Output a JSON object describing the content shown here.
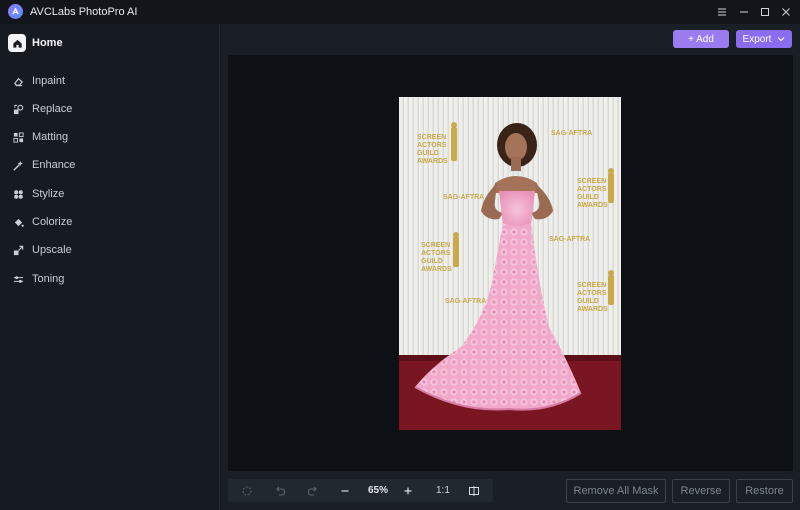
{
  "window": {
    "title": "AVCLabs PhotoPro AI",
    "logo_icon": "avclabs-logo-icon",
    "controls": [
      "menu-icon",
      "minimize-icon",
      "maximize-icon",
      "close-icon"
    ]
  },
  "sidebar": {
    "home": {
      "label": "Home",
      "icon": "home-icon"
    },
    "items": [
      {
        "label": "Inpaint",
        "icon": "eraser-icon"
      },
      {
        "label": "Replace",
        "icon": "replace-icon"
      },
      {
        "label": "Matting",
        "icon": "matting-icon"
      },
      {
        "label": "Enhance",
        "icon": "enhance-icon"
      },
      {
        "label": "Stylize",
        "icon": "stylize-icon"
      },
      {
        "label": "Colorize",
        "icon": "colorize-icon"
      },
      {
        "label": "Upscale",
        "icon": "upscale-icon"
      },
      {
        "label": "Toning",
        "icon": "toning-icon"
      }
    ]
  },
  "header": {
    "add_label": "+ Add",
    "export_label": "Export"
  },
  "photo": {
    "backdrop_logo_lines": [
      "SCREEN",
      "ACTORS",
      "GUILD",
      "AWARDS"
    ],
    "backdrop_brand": "SAG-AFTRA"
  },
  "toolbar": {
    "zoom": "65%",
    "ratio": "1:1"
  },
  "actions": {
    "remove_all_mask": "Remove All Mask",
    "reverse": "Reverse",
    "restore": "Restore"
  },
  "colors": {
    "accent": "#9a7bf0",
    "carpet": "#7a1522",
    "gown": "#f0a9c8"
  }
}
